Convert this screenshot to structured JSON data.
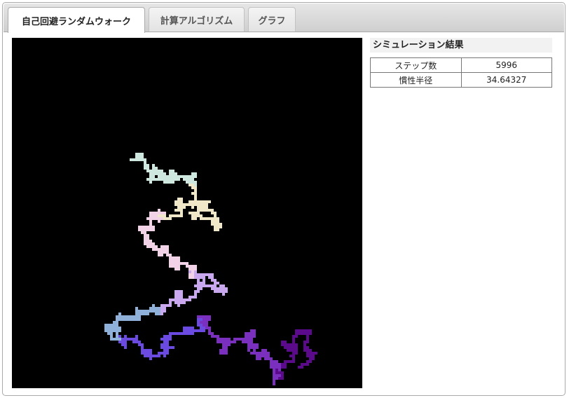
{
  "tabs": [
    {
      "label": "自己回避ランダムウォーク",
      "active": true
    },
    {
      "label": "計算アルゴリズム",
      "active": false
    },
    {
      "label": "グラフ",
      "active": false
    }
  ],
  "results": {
    "title": "シミュレーション結果",
    "rows": [
      {
        "label": "ステップ数",
        "value": "5996"
      },
      {
        "label": "慣性半径",
        "value": "34.64327"
      }
    ]
  },
  "simulation": {
    "steps": 5996,
    "background": "#000000",
    "colors": [
      "#5a0a8a",
      "#7b2fbf",
      "#6a4ae0",
      "#8fb0d8",
      "#c9a8f0",
      "#f2d2e6",
      "#f0e6c8",
      "#cfe8df"
    ]
  }
}
